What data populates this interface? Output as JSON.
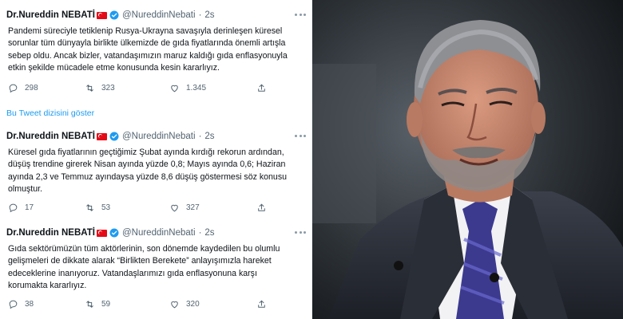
{
  "tweets": [
    {
      "name": "Dr.Nureddin NEBATİ",
      "handle": "@NureddinNebati",
      "separator": "·",
      "time": "2s",
      "lines": [
        "Pandemi süreciyle tetiklenip Rusya-Ukrayna savaşıyla derinleşen küresel",
        "sorunlar tüm dünyayla birlikte ülkemizde de gıda fiyatlarında önemli artışla",
        "sebep oldu. Ancak bizler, vatandaşımızın maruz kaldığı gıda enflasyonuyla",
        "etkin şekilde mücadele etme konusunda kesin kararlıyız."
      ],
      "replies": "298",
      "retweets": "323",
      "likes": "1.345"
    },
    {
      "name": "Dr.Nureddin NEBATİ",
      "handle": "@NureddinNebati",
      "separator": "·",
      "time": "2s",
      "lines": [
        "Küresel gıda fiyatlarının geçtiğimiz Şubat ayında kırdığı rekorun ardından,",
        "düşüş trendine girerek Nisan ayında yüzde 0,8; Mayıs ayında 0,6; Haziran",
        "ayında 2,3 ve Temmuz ayındaysa yüzde 8,6 düşüş göstermesi söz konusu",
        "olmuştur."
      ],
      "replies": "17",
      "retweets": "53",
      "likes": "327"
    },
    {
      "name": "Dr.Nureddin NEBATİ",
      "handle": "@NureddinNebati",
      "separator": "·",
      "time": "2s",
      "lines": [
        "Gıda sektörümüzün tüm aktörlerinin, son dönemde kaydedilen bu olumlu",
        "gelişmeleri de dikkate alarak “Birlikten Berekete” anlayışımızla hareket",
        "edeceklerine inanıyoruz. Vatandaşlarımızı gıda enflasyonuna karşı",
        "korumakta kararlıyız."
      ],
      "replies": "38",
      "retweets": "59",
      "likes": "320"
    }
  ],
  "thread_link": "Bu Tweet dizisini göster",
  "colors": {
    "accent": "#1d9bf0",
    "text": "#0f1419",
    "muted": "#536471",
    "flag": "#e30a17"
  },
  "icons": [
    "turkey-flag-icon",
    "verified-badge-icon",
    "more-icon",
    "reply-icon",
    "retweet-icon",
    "like-icon",
    "share-icon"
  ]
}
